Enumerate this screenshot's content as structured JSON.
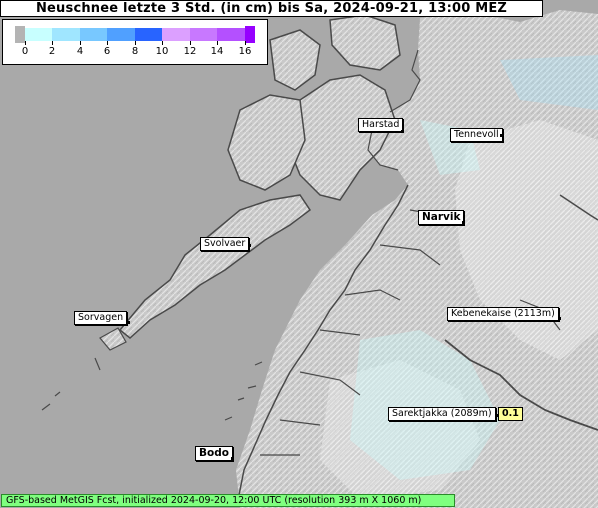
{
  "title": "Neuschnee letzte 3 Std. (in cm) bis Sa, 2024-09-21, 13:00 MEZ",
  "legend": {
    "ticks": [
      "0",
      "2",
      "4",
      "6",
      "8",
      "10",
      "12",
      "14",
      "16"
    ],
    "colors": [
      "#c8ffff",
      "#a0e6ff",
      "#78c8ff",
      "#50a0ff",
      "#2864ff",
      "#dca0ff",
      "#c878ff",
      "#b450ff"
    ],
    "under_color": "#b4b4b4",
    "over_color": "#9600ff"
  },
  "places": [
    {
      "name": "Harstad",
      "weight": "normal"
    },
    {
      "name": "Tennevoll",
      "weight": "normal"
    },
    {
      "name": "Narvik",
      "weight": "bold"
    },
    {
      "name": "Svolvaer",
      "weight": "normal"
    },
    {
      "name": "Sorvagen",
      "weight": "normal"
    },
    {
      "name": "Kebenekaise (2113m)",
      "weight": "normal"
    },
    {
      "name": "Sarektjakka (2089m)",
      "weight": "normal"
    },
    {
      "name": "Bodo",
      "weight": "bold"
    }
  ],
  "value_marker": {
    "value": "0.1",
    "color": "#ffff99"
  },
  "footer": "GFS-based MetGIS Fcst, initialized 2024-09-20, 12:00 UTC  (resolution 393 m X 1060 m)",
  "colors": {
    "sea": "#a9a9a9",
    "land": "#c4c4c4",
    "land_light": "#e8e8e8",
    "snow_trace": "#c8ffff",
    "footer_bg": "#7fff7f"
  }
}
